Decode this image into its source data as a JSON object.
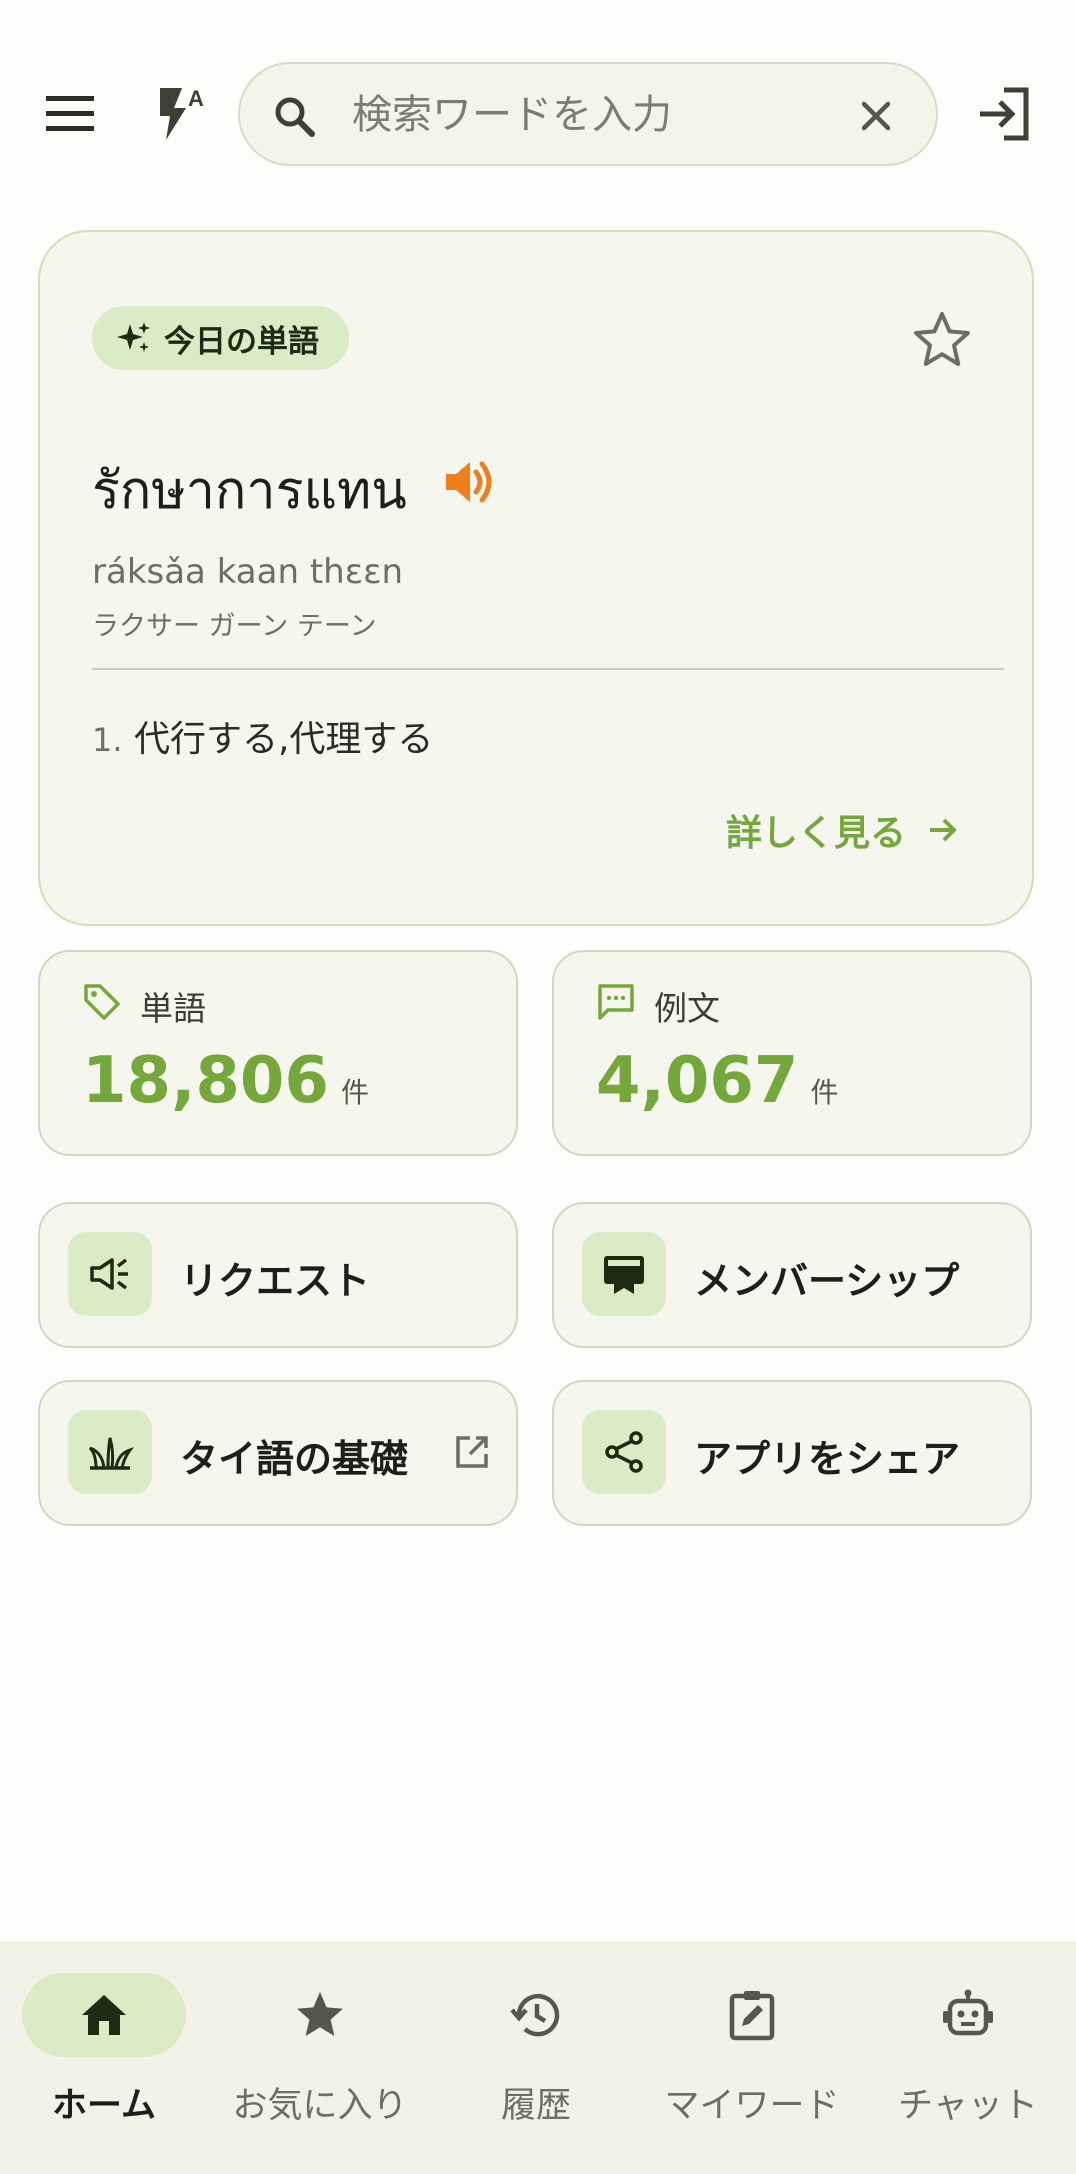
{
  "search": {
    "placeholder": "検索ワードを入力",
    "value": ""
  },
  "word_of_the_day": {
    "badge": "今日の単語",
    "thai": "รักษาการแทน",
    "romanization": "ráksǎa kaan thɛɛn",
    "katakana": "ラクサー ガーン テーン",
    "meaning_number": "1.",
    "meaning": "代行する,代理する",
    "more_label": "詳しく見る"
  },
  "stats": {
    "words": {
      "label": "単語",
      "value": "18,806",
      "unit": "件"
    },
    "examples": {
      "label": "例文",
      "value": "4,067",
      "unit": "件"
    }
  },
  "actions": {
    "request": "リクエスト",
    "membership": "メンバーシップ",
    "basics": "タイ語の基礎",
    "share": "アプリをシェア"
  },
  "nav": {
    "home": "ホーム",
    "favorites": "お気に入り",
    "history": "履歴",
    "mywords": "マイワード",
    "chat": "チャット"
  },
  "colors": {
    "accent": "#75a83b",
    "badge_bg": "#dbebc5",
    "speaker": "#ef7f1a"
  }
}
